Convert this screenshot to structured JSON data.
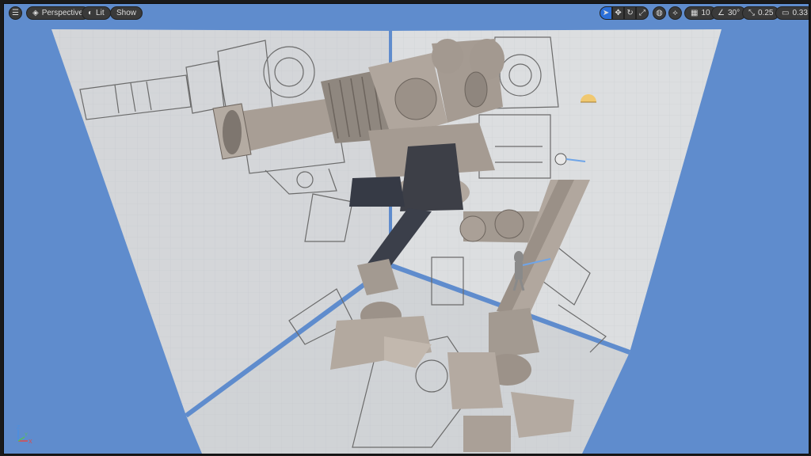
{
  "toolbar": {
    "menu_icon": "hamburger-icon",
    "perspective_label": "Perspective",
    "lit_label": "Lit",
    "show_label": "Show",
    "grid_snap_value": "10",
    "rotation_snap_value": "30°",
    "scale_snap_value": "0.25",
    "camera_speed_value": "0.33"
  },
  "gizmo": {
    "x_label": "X",
    "y_label": "Y",
    "z_label": "Z"
  },
  "colors": {
    "viewport_bg": "#5f8ccd",
    "toolbar_bg": "#3a3a3a",
    "accent": "#2b6fd8",
    "floor_grid": "#d3d6d9",
    "mesh": "#ada39a"
  }
}
